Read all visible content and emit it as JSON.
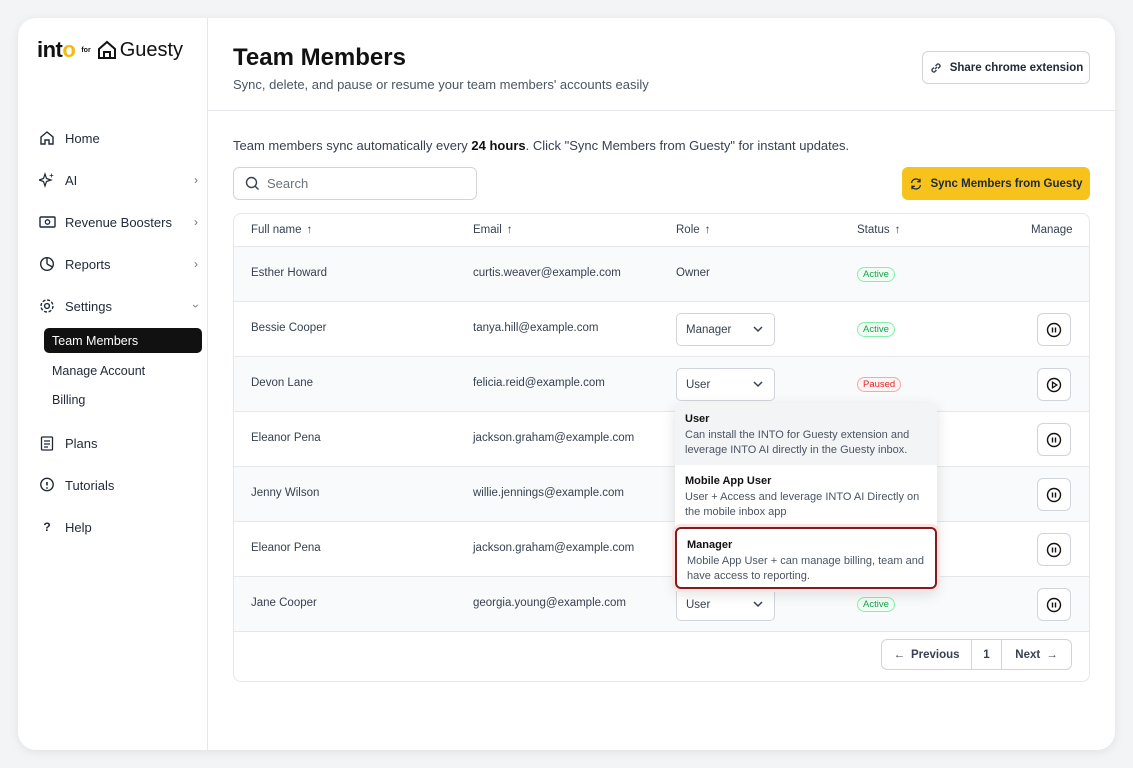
{
  "brand": {
    "into": "into",
    "for": "for",
    "guesty": "Guesty"
  },
  "nav": {
    "home": "Home",
    "ai": "AI",
    "revenue": "Revenue Boosters",
    "reports": "Reports",
    "settings": "Settings",
    "team_members": "Team Members",
    "manage_account": "Manage Account",
    "billing": "Billing",
    "plans": "Plans",
    "tutorials": "Tutorials",
    "help": "Help"
  },
  "header": {
    "title": "Team Members",
    "subtitle": "Sync, delete, and pause or resume your team members' accounts easily",
    "share_label": "Share chrome extension"
  },
  "info": {
    "prefix": "Team members sync automatically every ",
    "bold": "24 hours",
    "suffix": ". Click \"Sync Members from Guesty\" for instant updates."
  },
  "search": {
    "placeholder": "Search"
  },
  "sync_label": "Sync Members from Guesty",
  "table": {
    "headers": {
      "name": "Full name",
      "email": "Email",
      "role": "Role",
      "status": "Status",
      "manage": "Manage"
    },
    "rows": [
      {
        "name": "Esther Howard",
        "email": "curtis.weaver@example.com",
        "role": "Owner",
        "status": "Active"
      },
      {
        "name": "Bessie Cooper",
        "email": "tanya.hill@example.com",
        "role": "Manager",
        "status": "Active"
      },
      {
        "name": "Devon Lane",
        "email": "felicia.reid@example.com",
        "role": "User",
        "status": "Paused"
      },
      {
        "name": "Eleanor Pena",
        "email": "jackson.graham@example.com",
        "role": "",
        "status": ""
      },
      {
        "name": "Jenny Wilson",
        "email": "willie.jennings@example.com",
        "role": "",
        "status": ""
      },
      {
        "name": "Eleanor Pena",
        "email": "jackson.graham@example.com",
        "role": "",
        "status": ""
      },
      {
        "name": "Jane Cooper",
        "email": "georgia.young@example.com",
        "role": "User",
        "status": "Active"
      }
    ]
  },
  "dropdown": {
    "options": [
      {
        "title": "User",
        "desc": "Can install the INTO for Guesty extension and leverage INTO AI directly in the Guesty inbox."
      },
      {
        "title": "Mobile App User",
        "desc": "User + Access and leverage INTO AI Directly on the mobile inbox app"
      },
      {
        "title": "Manager",
        "desc": "Mobile App User + can manage billing, team and have access to reporting."
      }
    ]
  },
  "pager": {
    "previous": "Previous",
    "page": "1",
    "next": "Next"
  },
  "colors": {
    "accent": "#f8c21c",
    "active": "#16a34a",
    "paused": "#dc2626",
    "selected_border": "#7f1d1d"
  }
}
